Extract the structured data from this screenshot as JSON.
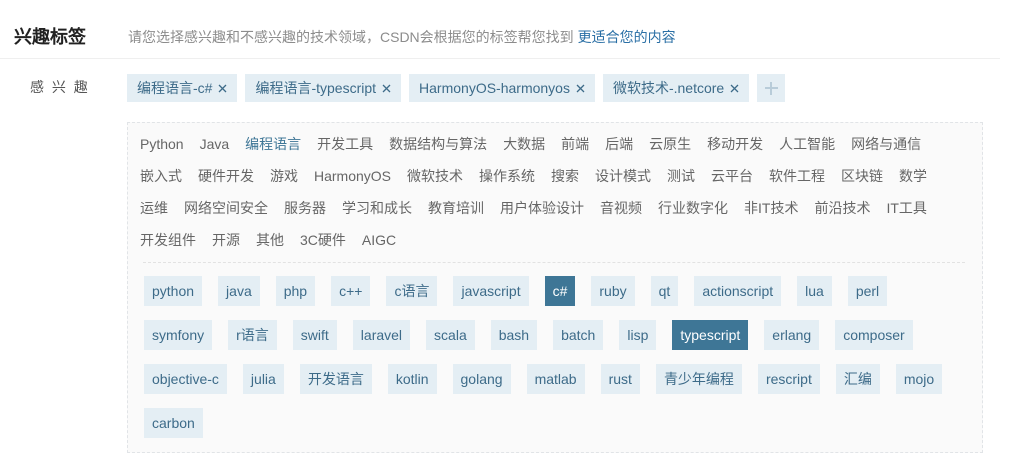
{
  "header": {
    "title": "兴趣标签",
    "description": "请您选择感兴趣和不感兴趣的技术领域，CSDN会根据您的标签帮您找到",
    "link_text": "更适合您的内容"
  },
  "interests": {
    "label": "感 兴 趣",
    "selected_tags": [
      {
        "label": "编程语言-c#",
        "remove_icon": "close-icon"
      },
      {
        "label": "编程语言-typescript",
        "remove_icon": "close-icon"
      },
      {
        "label": "HarmonyOS-harmonyos",
        "remove_icon": "close-icon"
      },
      {
        "label": "微软技术-.netcore",
        "remove_icon": "close-icon"
      }
    ],
    "add_button": {
      "icon": "plus-icon"
    }
  },
  "categories": {
    "active": "编程语言",
    "rows": [
      [
        "Python",
        "Java",
        "编程语言",
        "开发工具",
        "数据结构与算法",
        "大数据",
        "前端",
        "后端",
        "云原生",
        "移动开发",
        "人工智能",
        "网络与通信"
      ],
      [
        "嵌入式",
        "硬件开发",
        "游戏",
        "HarmonyOS",
        "微软技术",
        "操作系统",
        "搜索",
        "设计模式",
        "测试",
        "云平台",
        "软件工程",
        "区块链",
        "数学"
      ],
      [
        "运维",
        "网络空间安全",
        "服务器",
        "学习和成长",
        "教育培训",
        "用户体验设计",
        "音视频",
        "行业数字化",
        "非IT技术",
        "前沿技术",
        "IT工具"
      ],
      [
        "开发组件",
        "开源",
        "其他",
        "3C硬件",
        "AIGC"
      ]
    ]
  },
  "subtags": {
    "selected": [
      "c#",
      "typescript"
    ],
    "rows": [
      [
        "python",
        "java",
        "php",
        "c++",
        "c语言",
        "javascript",
        "c#",
        "ruby",
        "qt",
        "actionscript",
        "lua",
        "perl"
      ],
      [
        "symfony",
        "r语言",
        "swift",
        "laravel",
        "scala",
        "bash",
        "batch",
        "lisp",
        "typescript",
        "erlang",
        "composer"
      ],
      [
        "objective-c",
        "julia",
        "开发语言",
        "kotlin",
        "golang",
        "matlab",
        "rust",
        "青少年编程",
        "rescript",
        "汇编",
        "mojo"
      ],
      [
        "carbon"
      ]
    ]
  },
  "colors": {
    "accent": "#3e7696",
    "tag_bg": "#e4eef4",
    "tag_text": "#3d6b89",
    "link": "#2a6fa5",
    "add_icon": "#b8ccd9"
  }
}
